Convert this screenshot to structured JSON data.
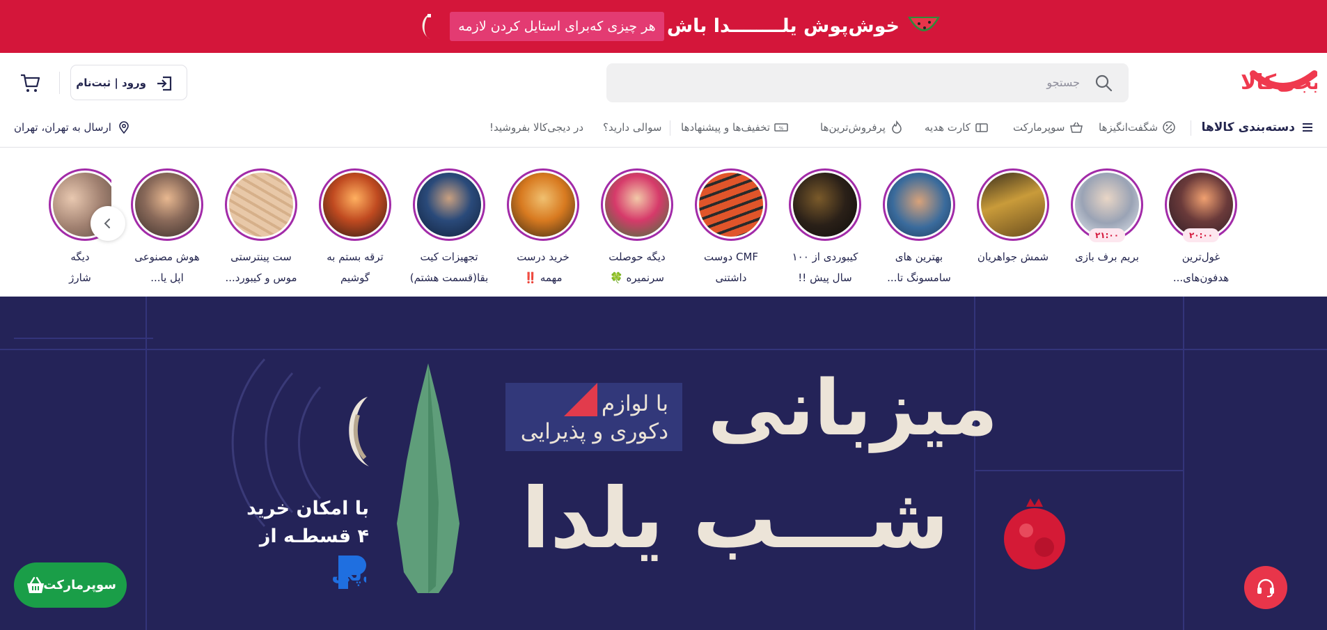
{
  "promo": {
    "main_text": "خوش‌پوش یلــــــــدا باش",
    "pill_text": "هر چیزی که‌برای استایل کردن لازمه"
  },
  "header": {
    "logo_text": "دیجی‌کالا",
    "search_placeholder": "جستجو",
    "login_label": "ورود | ثبت‌نام",
    "shipping_label": "ارسال به تهران، تهران",
    "categories_label": "دسته‌بندی کالاها",
    "nav_items": [
      "شگفت‌انگیزها",
      "سوپرمارکت",
      "کارت هدیه",
      "پرفروش‌ترین‌ها",
      "تخفیف‌ها و پیشنهادها",
      "سوالی دارید؟",
      "در دیجی‌کالا بفروشید!"
    ]
  },
  "stories": [
    {
      "line1": "غول‌ترین",
      "line2": "هدفون‌های...",
      "time": "۲۰:۰۰"
    },
    {
      "line1": "بریم برف بازی",
      "line2": "",
      "time": "۲۱:۰۰"
    },
    {
      "line1": "شمش جواهریان",
      "line2": "",
      "time": ""
    },
    {
      "line1": "بهترین های",
      "line2": "سامسونگ تا...",
      "time": ""
    },
    {
      "line1": "کیبوردی از ۱۰۰",
      "line2": "سال پیش !!",
      "time": ""
    },
    {
      "line1": "CMF دوست",
      "line2": "داشتنی",
      "time": ""
    },
    {
      "line1": "دیگه حوصلت",
      "line2": "سرنمیره 🍀",
      "time": ""
    },
    {
      "line1": "خرید درست",
      "line2": "مهمه ‼️",
      "time": ""
    },
    {
      "line1": "تجهیزات کیت",
      "line2": "بقا(قسمت هشتم)",
      "time": ""
    },
    {
      "line1": "ترقه بستم به",
      "line2": "گوشیم",
      "time": ""
    },
    {
      "line1": "ست پینترستی",
      "line2": "موس و کیبورد...",
      "time": ""
    },
    {
      "line1": "هوش مصنوعی",
      "line2": "اپل یا...",
      "time": ""
    },
    {
      "line1": "دیگه",
      "line2": "شارژ",
      "time": ""
    }
  ],
  "hero": {
    "title_line1": "میزبانی",
    "title_line2": "شـــب یلدا",
    "badge_line1": "با لوازم",
    "badge_line2": "دکوری و پذیرایی",
    "installment_line1": "با امکان خرید",
    "installment_line2": "۴ قسطـه از",
    "pay_logo_text": "دیجی‌پی"
  },
  "floating": {
    "supermarket_label": "سوپرمارکت"
  },
  "colors": {
    "brand_red": "#d4163a",
    "hero_bg": "#242358",
    "supermarket_green": "#1a9e48",
    "story_ring": "#a22ba8"
  }
}
